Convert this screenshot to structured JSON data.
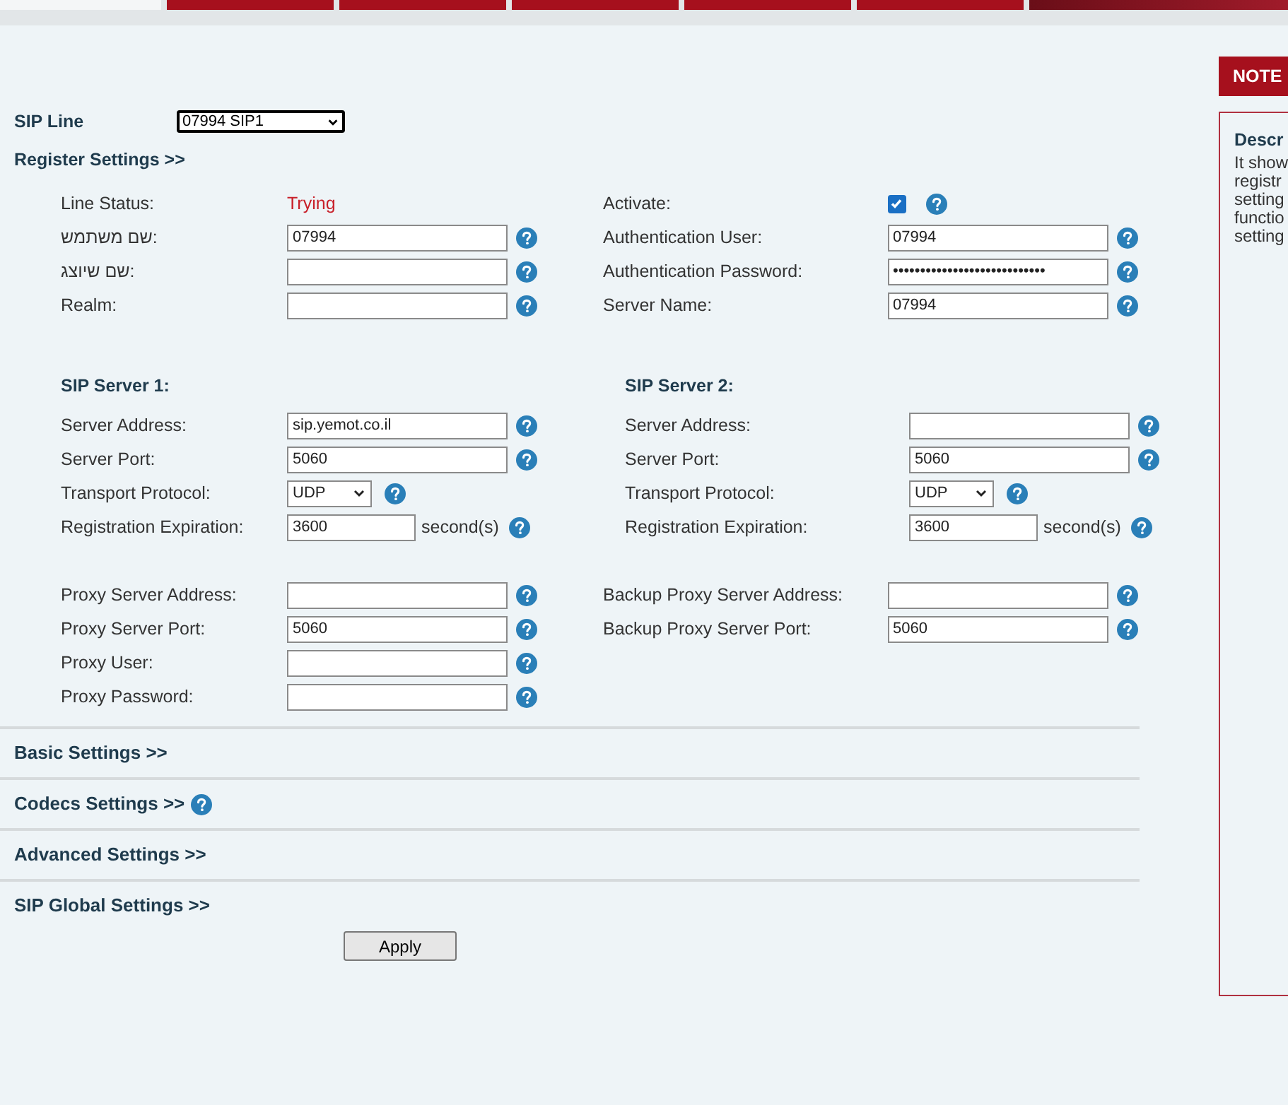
{
  "tabs": [
    {
      "selected": true
    },
    {
      "selected": false
    },
    {
      "selected": false
    },
    {
      "selected": false
    },
    {
      "selected": false
    },
    {
      "selected": false
    }
  ],
  "sip_line": {
    "label": "SIP Line",
    "value": "07994 SIP1"
  },
  "register": {
    "title": "Register Settings >>",
    "left": [
      {
        "kind": "status",
        "label": "Line Status:",
        "value": "Trying"
      },
      {
        "kind": "field",
        "label": "שם משתמש:",
        "value": "07994"
      },
      {
        "kind": "field",
        "label": "שם שיוצג:"
      },
      {
        "kind": "field",
        "label": "Realm:"
      }
    ],
    "right": [
      {
        "kind": "checkbox",
        "label": "Activate:",
        "checked": true
      },
      {
        "kind": "field",
        "label": "Authentication User:",
        "value": "07994"
      },
      {
        "kind": "field",
        "label": "Authentication Password:",
        "value": "••••••••••••••••••••••••••••"
      },
      {
        "kind": "field",
        "label": "Server Name:",
        "value": "07994"
      }
    ]
  },
  "servers": [
    {
      "title": "SIP Server 1:",
      "rows": [
        {
          "kind": "field",
          "label": "Server Address:",
          "value": "sip.yemot.co.il"
        },
        {
          "kind": "field",
          "label": "Server Port:",
          "value": "5060"
        },
        {
          "kind": "select",
          "label": "Transport Protocol:",
          "value": "UDP"
        },
        {
          "kind": "unit",
          "label": "Registration Expiration:",
          "value": "3600",
          "unit": "second(s)"
        }
      ]
    },
    {
      "title": "SIP Server 2:",
      "rows": [
        {
          "kind": "field",
          "label": "Server Address:"
        },
        {
          "kind": "field",
          "label": "Server Port:",
          "value": "5060"
        },
        {
          "kind": "select",
          "label": "Transport Protocol:",
          "value": "UDP"
        },
        {
          "kind": "unit",
          "label": "Registration Expiration:",
          "value": "3600",
          "unit": "second(s)"
        }
      ]
    }
  ],
  "proxy": {
    "left": [
      {
        "kind": "field",
        "label": "Proxy Server Address:"
      },
      {
        "kind": "field",
        "label": "Proxy Server Port:",
        "value": "5060"
      },
      {
        "kind": "field",
        "label": "Proxy User:"
      },
      {
        "kind": "field",
        "label": "Proxy Password:"
      }
    ],
    "right": [
      {
        "kind": "field",
        "label": "Backup Proxy Server Address:"
      },
      {
        "kind": "field",
        "label": "Backup Proxy Server Port:",
        "value": "5060"
      }
    ]
  },
  "sections": [
    {
      "title": "Basic Settings >>",
      "help": false
    },
    {
      "title": "Codecs Settings >>",
      "help": true
    },
    {
      "title": "Advanced Settings >>",
      "help": false
    },
    {
      "title": "SIP Global Settings >>",
      "help": false
    }
  ],
  "apply": "Apply",
  "note": {
    "tab": "NOTE",
    "title": "Descr",
    "lines": [
      "It show",
      "registr",
      "setting",
      "functio",
      "setting"
    ]
  }
}
